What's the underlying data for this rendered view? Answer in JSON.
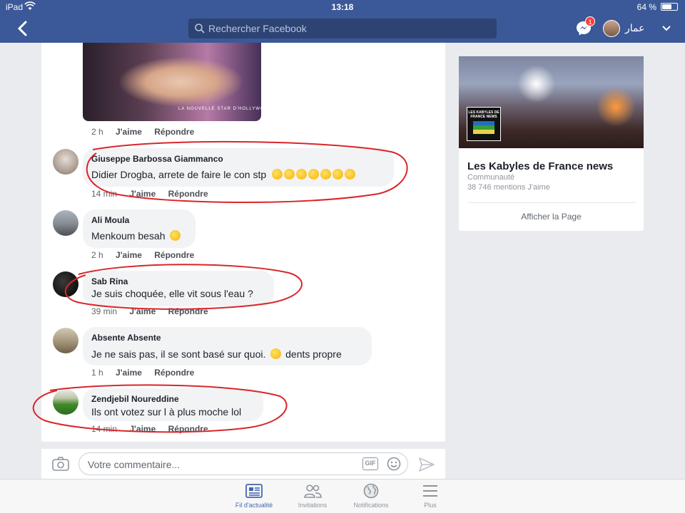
{
  "status_bar": {
    "carrier": "iPad",
    "time": "13:18",
    "battery_percent": "64 %",
    "battery_level": 0.64
  },
  "nav": {
    "search_placeholder": "Rechercher Facebook",
    "messenger_badge": "1",
    "user_name": "عمار"
  },
  "post": {
    "video_caption": "LA NOUVELLE STAR D'HOLLYWOOD",
    "meta": {
      "time": "2 h",
      "like": "J'aime",
      "reply": "Répondre"
    }
  },
  "comments": [
    {
      "name": "Giuseppe Barbossa Giammanco",
      "text": "Didier Drogba,  arrete de faire le con stp",
      "emoji_count": 7,
      "time": "14 min",
      "like": "J'aime",
      "reply": "Répondre",
      "circled": true
    },
    {
      "name": "Ali Moula",
      "text": "Menkoum besah",
      "emoji_count": 1,
      "time": "2 h",
      "like": "J'aime",
      "reply": "Répondre",
      "circled": false
    },
    {
      "name": "Sab Rina",
      "text": "Je suis choquée, elle vit sous l'eau ?",
      "emoji_count": 0,
      "time": "39 min",
      "like": "J'aime",
      "reply": "Répondre",
      "circled": true
    },
    {
      "name": "Absente Absente",
      "text": "Je ne sais pas,  il se sont basé sur quoi.",
      "text_after": "dents propre",
      "emoji_count": 1,
      "time": "1 h",
      "like": "J'aime",
      "reply": "Répondre",
      "circled": false
    },
    {
      "name": "Zendjebil Noureddine",
      "text": "Ils ont votez sur l à plus moche lol",
      "emoji_count": 0,
      "time": "14 min",
      "like": "J'aime",
      "reply": "Répondre",
      "circled": true
    }
  ],
  "composer": {
    "placeholder": "Votre commentaire...",
    "gif_label": "GIF"
  },
  "page_card": {
    "logo_text": "LES KABYLES DE FRANCE NEWS",
    "name": "Les Kabyles de France news",
    "category": "Communauté",
    "likes": "38 746 mentions J'aime",
    "button": "Afficher la Page"
  },
  "tabs": [
    {
      "label": "Fil d'actualité",
      "icon": "news-feed-icon",
      "active": true
    },
    {
      "label": "Invitations",
      "icon": "friends-icon",
      "active": false
    },
    {
      "label": "Notifications",
      "icon": "globe-icon",
      "active": false
    },
    {
      "label": "Plus",
      "icon": "hamburger-icon",
      "active": false
    }
  ],
  "colors": {
    "brand": "#3b5998",
    "annotation": "#d9262a",
    "active_tab": "#4267b2"
  }
}
